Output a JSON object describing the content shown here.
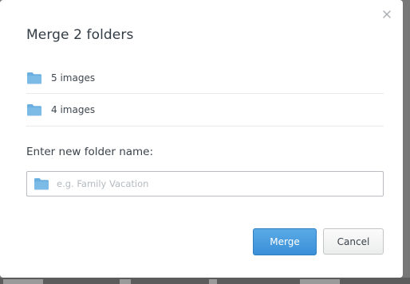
{
  "dialog": {
    "title": "Merge 2 folders",
    "folders": [
      {
        "label": "5 images",
        "icon": "folder-icon"
      },
      {
        "label": "4 images",
        "icon": "folder-icon"
      }
    ],
    "name_field": {
      "label": "Enter new folder name:",
      "placeholder": "e.g. Family Vacation",
      "value": "",
      "icon": "folder-icon"
    },
    "buttons": {
      "merge": "Merge",
      "cancel": "Cancel"
    },
    "close_icon": "close-icon"
  },
  "colors": {
    "accent": "#3d91d8",
    "folder": "#6aafe0",
    "overlay": "#777777"
  }
}
